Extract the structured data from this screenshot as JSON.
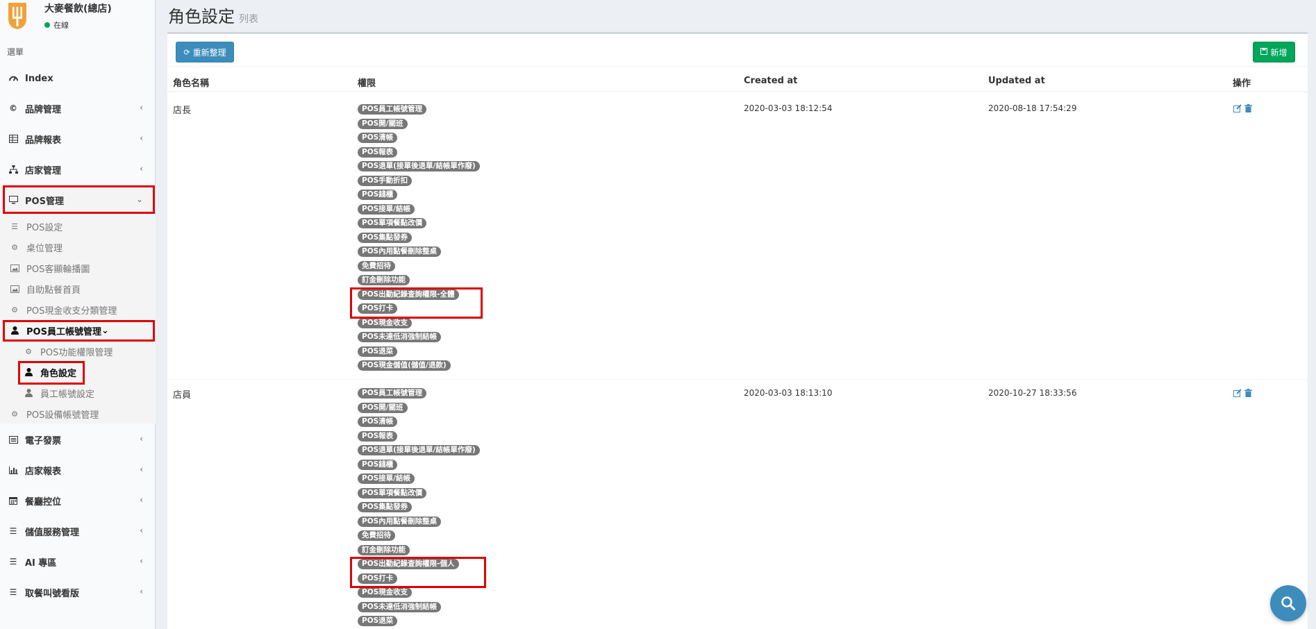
{
  "brand": {
    "name": "大麥餐飲(總店)",
    "status": "在線"
  },
  "sidebar": {
    "header": "選單",
    "items": [
      {
        "label": "Index",
        "icon": "dashboard-icon"
      },
      {
        "label": "品牌管理",
        "icon": "copyright-icon"
      },
      {
        "label": "品牌報表",
        "icon": "table-icon"
      },
      {
        "label": "店家管理",
        "icon": "sitemap-icon"
      },
      {
        "label": "POS管理",
        "icon": "desktop-icon"
      },
      {
        "label": "電子發票",
        "icon": "invoice-icon"
      },
      {
        "label": "店家報表",
        "icon": "bar-chart-icon"
      },
      {
        "label": "餐廳控位",
        "icon": "calendar-icon"
      },
      {
        "label": "儲值服務管理",
        "icon": "bars-icon"
      },
      {
        "label": "AI 專區",
        "icon": "bars-icon"
      },
      {
        "label": "取餐叫號看版",
        "icon": "bars-icon"
      }
    ],
    "pos_sub": [
      {
        "label": "POS設定",
        "icon": "bars-icon"
      },
      {
        "label": "桌位管理",
        "icon": "gear-icon"
      },
      {
        "label": "POS客顯輪播圖",
        "icon": "image-icon"
      },
      {
        "label": "自助點餐首頁",
        "icon": "image-icon"
      },
      {
        "label": "POS現金收支分類管理",
        "icon": "gear-icon"
      },
      {
        "label": "POS員工帳號管理",
        "icon": "user-icon"
      },
      {
        "label": "POS設備帳號管理",
        "icon": "gear-icon"
      }
    ],
    "staff_sub": [
      {
        "label": "POS功能權限管理",
        "icon": "gear-icon"
      },
      {
        "label": "角色設定",
        "icon": "user-icon"
      },
      {
        "label": "員工帳號設定",
        "icon": "user-icon"
      }
    ]
  },
  "page": {
    "title": "角色設定",
    "subtitle": "列表"
  },
  "toolbar": {
    "refresh_label": "重新整理",
    "add_label": "新增"
  },
  "table": {
    "headers": [
      "角色名稱",
      "權限",
      "Created at",
      "Updated at",
      "操作"
    ],
    "rows": [
      {
        "name": "店長",
        "created": "2020-03-03 18:12:54",
        "updated": "2020-08-18 17:54:29",
        "perms": [
          "POS員工帳號管理",
          "POS開/關班",
          "POS清帳",
          "POS報表",
          "POS退單(接單後退單/結帳單作廢)",
          "POS手動折扣",
          "POS錢櫃",
          "POS接單/結帳",
          "POS單項餐點改價",
          "POS集點發券",
          "POS內用點餐刪除整桌",
          "免費招待",
          "訂金刪除功能",
          "POS出勤紀錄查詢權限-全體",
          "POS打卡",
          "POS現金收支",
          "POS未達低消強制結帳",
          "POS退菜",
          "POS現金儲值(儲值/退款)"
        ]
      },
      {
        "name": "店員",
        "created": "2020-03-03 18:13:10",
        "updated": "2020-10-27 18:33:56",
        "perms": [
          "POS員工帳號管理",
          "POS開/關班",
          "POS清帳",
          "POS報表",
          "POS退單(接單後退單/結帳單作廢)",
          "POS錢櫃",
          "POS接單/結帳",
          "POS單項餐點改價",
          "POS集點發券",
          "POS內用點餐刪除整桌",
          "免費招待",
          "訂金刪除功能",
          "POS出勤紀錄查詢權限-個人",
          "POS打卡",
          "POS現金收支",
          "POS未達低消強制結帳",
          "POS退菜"
        ]
      }
    ]
  },
  "colors": {
    "primary": "#3c8dbc",
    "success": "#00a65a",
    "label": "#777777",
    "highlight": "#e00000",
    "online": "#00a65a"
  }
}
